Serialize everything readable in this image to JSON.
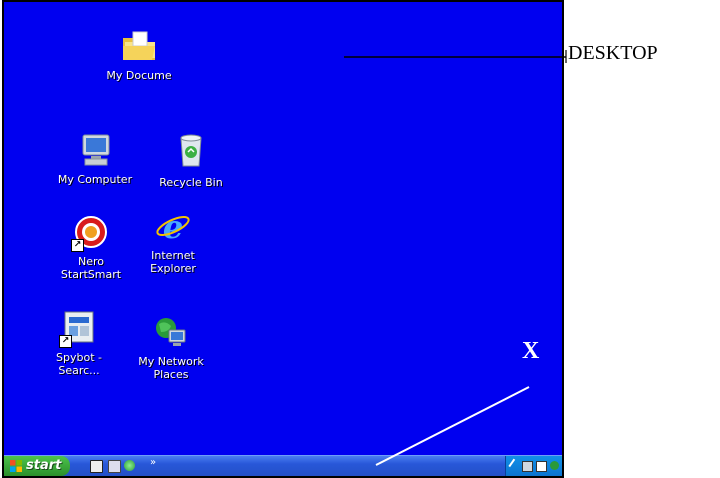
{
  "desktop": {
    "icons": [
      {
        "label": "My Docume",
        "icon": "folder-icon"
      },
      {
        "label": "My Computer",
        "icon": "computer-icon"
      },
      {
        "label": "Recycle Bin",
        "icon": "recycle-bin-icon"
      },
      {
        "label": "Nero\nStartSmart",
        "icon": "nero-icon"
      },
      {
        "label": "Internet\nExplorer",
        "icon": "internet-explorer-icon"
      },
      {
        "label": "Spybot -\nSearc...",
        "icon": "spybot-icon"
      },
      {
        "label": "My Network\nPlaces",
        "icon": "network-places-icon"
      }
    ]
  },
  "taskbar": {
    "start_label": "start",
    "quick_launch_overflow": "»"
  },
  "annotations": {
    "desktop_label": "DESKTOP",
    "x_label": "X"
  },
  "colors": {
    "desktop_bg": "#0000f0",
    "taskbar": "#2857d8",
    "start_button": "#3aa83a"
  }
}
